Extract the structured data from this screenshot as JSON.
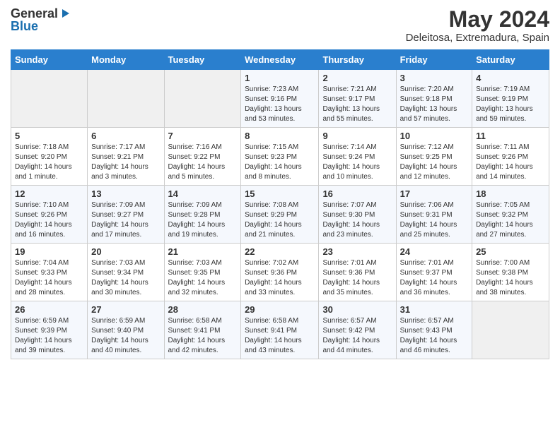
{
  "logo": {
    "general": "General",
    "blue": "Blue"
  },
  "title": {
    "month": "May 2024",
    "location": "Deleitosa, Extremadura, Spain"
  },
  "days_of_week": [
    "Sunday",
    "Monday",
    "Tuesday",
    "Wednesday",
    "Thursday",
    "Friday",
    "Saturday"
  ],
  "weeks": [
    [
      {
        "day": "",
        "info": ""
      },
      {
        "day": "",
        "info": ""
      },
      {
        "day": "",
        "info": ""
      },
      {
        "day": "1",
        "info": "Sunrise: 7:23 AM\nSunset: 9:16 PM\nDaylight: 13 hours and 53 minutes."
      },
      {
        "day": "2",
        "info": "Sunrise: 7:21 AM\nSunset: 9:17 PM\nDaylight: 13 hours and 55 minutes."
      },
      {
        "day": "3",
        "info": "Sunrise: 7:20 AM\nSunset: 9:18 PM\nDaylight: 13 hours and 57 minutes."
      },
      {
        "day": "4",
        "info": "Sunrise: 7:19 AM\nSunset: 9:19 PM\nDaylight: 13 hours and 59 minutes."
      }
    ],
    [
      {
        "day": "5",
        "info": "Sunrise: 7:18 AM\nSunset: 9:20 PM\nDaylight: 14 hours and 1 minute."
      },
      {
        "day": "6",
        "info": "Sunrise: 7:17 AM\nSunset: 9:21 PM\nDaylight: 14 hours and 3 minutes."
      },
      {
        "day": "7",
        "info": "Sunrise: 7:16 AM\nSunset: 9:22 PM\nDaylight: 14 hours and 5 minutes."
      },
      {
        "day": "8",
        "info": "Sunrise: 7:15 AM\nSunset: 9:23 PM\nDaylight: 14 hours and 8 minutes."
      },
      {
        "day": "9",
        "info": "Sunrise: 7:14 AM\nSunset: 9:24 PM\nDaylight: 14 hours and 10 minutes."
      },
      {
        "day": "10",
        "info": "Sunrise: 7:12 AM\nSunset: 9:25 PM\nDaylight: 14 hours and 12 minutes."
      },
      {
        "day": "11",
        "info": "Sunrise: 7:11 AM\nSunset: 9:26 PM\nDaylight: 14 hours and 14 minutes."
      }
    ],
    [
      {
        "day": "12",
        "info": "Sunrise: 7:10 AM\nSunset: 9:26 PM\nDaylight: 14 hours and 16 minutes."
      },
      {
        "day": "13",
        "info": "Sunrise: 7:09 AM\nSunset: 9:27 PM\nDaylight: 14 hours and 17 minutes."
      },
      {
        "day": "14",
        "info": "Sunrise: 7:09 AM\nSunset: 9:28 PM\nDaylight: 14 hours and 19 minutes."
      },
      {
        "day": "15",
        "info": "Sunrise: 7:08 AM\nSunset: 9:29 PM\nDaylight: 14 hours and 21 minutes."
      },
      {
        "day": "16",
        "info": "Sunrise: 7:07 AM\nSunset: 9:30 PM\nDaylight: 14 hours and 23 minutes."
      },
      {
        "day": "17",
        "info": "Sunrise: 7:06 AM\nSunset: 9:31 PM\nDaylight: 14 hours and 25 minutes."
      },
      {
        "day": "18",
        "info": "Sunrise: 7:05 AM\nSunset: 9:32 PM\nDaylight: 14 hours and 27 minutes."
      }
    ],
    [
      {
        "day": "19",
        "info": "Sunrise: 7:04 AM\nSunset: 9:33 PM\nDaylight: 14 hours and 28 minutes."
      },
      {
        "day": "20",
        "info": "Sunrise: 7:03 AM\nSunset: 9:34 PM\nDaylight: 14 hours and 30 minutes."
      },
      {
        "day": "21",
        "info": "Sunrise: 7:03 AM\nSunset: 9:35 PM\nDaylight: 14 hours and 32 minutes."
      },
      {
        "day": "22",
        "info": "Sunrise: 7:02 AM\nSunset: 9:36 PM\nDaylight: 14 hours and 33 minutes."
      },
      {
        "day": "23",
        "info": "Sunrise: 7:01 AM\nSunset: 9:36 PM\nDaylight: 14 hours and 35 minutes."
      },
      {
        "day": "24",
        "info": "Sunrise: 7:01 AM\nSunset: 9:37 PM\nDaylight: 14 hours and 36 minutes."
      },
      {
        "day": "25",
        "info": "Sunrise: 7:00 AM\nSunset: 9:38 PM\nDaylight: 14 hours and 38 minutes."
      }
    ],
    [
      {
        "day": "26",
        "info": "Sunrise: 6:59 AM\nSunset: 9:39 PM\nDaylight: 14 hours and 39 minutes."
      },
      {
        "day": "27",
        "info": "Sunrise: 6:59 AM\nSunset: 9:40 PM\nDaylight: 14 hours and 40 minutes."
      },
      {
        "day": "28",
        "info": "Sunrise: 6:58 AM\nSunset: 9:41 PM\nDaylight: 14 hours and 42 minutes."
      },
      {
        "day": "29",
        "info": "Sunrise: 6:58 AM\nSunset: 9:41 PM\nDaylight: 14 hours and 43 minutes."
      },
      {
        "day": "30",
        "info": "Sunrise: 6:57 AM\nSunset: 9:42 PM\nDaylight: 14 hours and 44 minutes."
      },
      {
        "day": "31",
        "info": "Sunrise: 6:57 AM\nSunset: 9:43 PM\nDaylight: 14 hours and 46 minutes."
      },
      {
        "day": "",
        "info": ""
      }
    ]
  ]
}
